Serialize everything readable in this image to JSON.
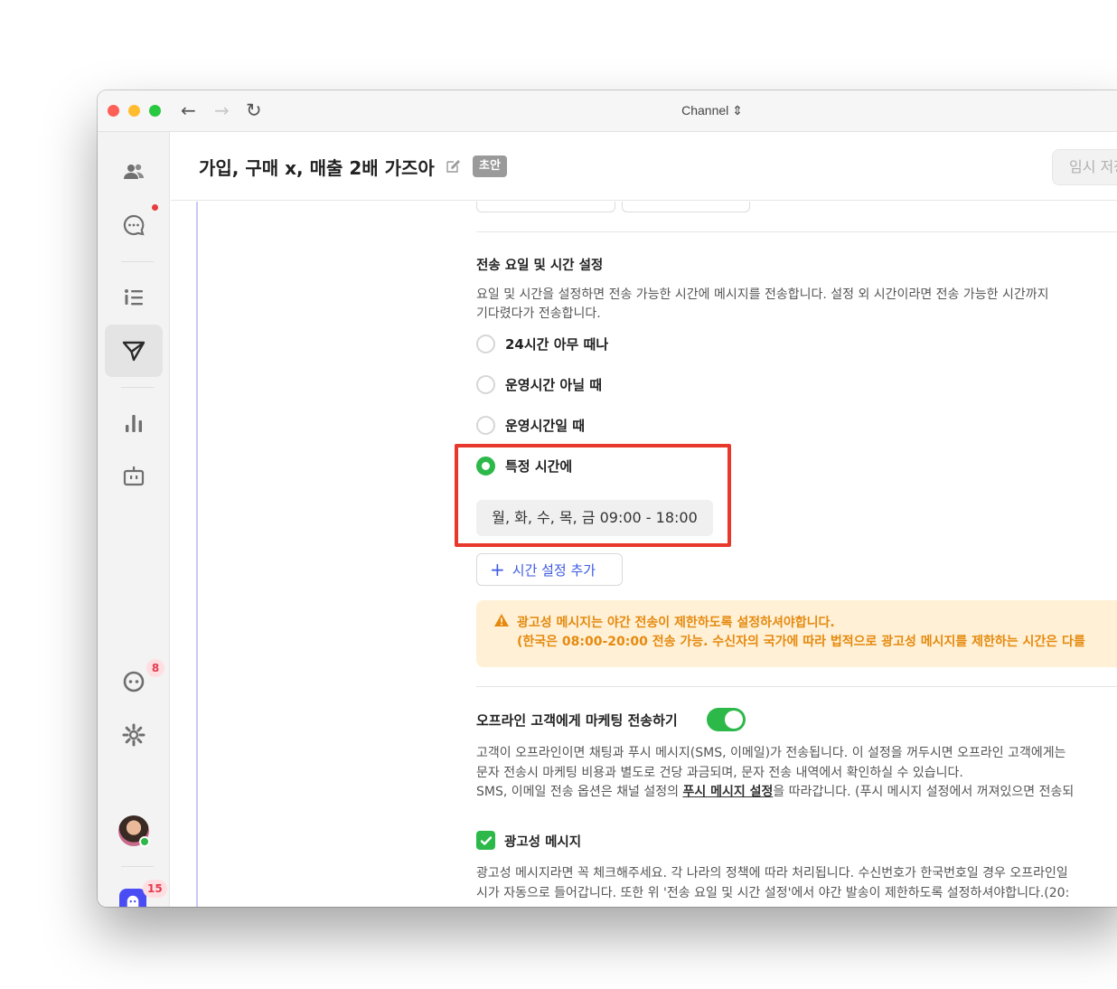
{
  "window": {
    "title": "Channel ⇕"
  },
  "nav": {
    "back": "←",
    "forward": "→",
    "reload": "↻"
  },
  "sidebar": {
    "items": [
      {
        "icon": "users-icon"
      },
      {
        "icon": "chat-icon",
        "has_dot": true
      },
      {
        "icon": "list-icon"
      },
      {
        "icon": "send-icon",
        "active": true
      },
      {
        "icon": "bar-chart-icon"
      },
      {
        "icon": "bot-icon"
      }
    ],
    "bottom": {
      "chat_badge": "8",
      "app_badge": "15"
    }
  },
  "header": {
    "title": "가입, 구매 x, 매출 2배 가즈아",
    "status_badge": "초안",
    "temp_save_label": "임시 저장"
  },
  "schedule": {
    "title": "전송 요일 및 시간 설정",
    "description_line1": "요일 및 시간을 설정하면 전송 가능한 시간에 메시지를 전송합니다. 설정 외 시간이라면 전송 가능한 시간까지",
    "description_line2": "기다렸다가 전송합니다.",
    "options": [
      {
        "label": "24시간 아무 때나",
        "checked": false
      },
      {
        "label": "운영시간 아닐 때",
        "checked": false
      },
      {
        "label": "운영시간일 때",
        "checked": false
      },
      {
        "label": "특정 시간에",
        "checked": true
      }
    ],
    "time_range": "월, 화, 수, 목, 금 09:00 - 18:00",
    "add_time_label": "시간 설정 추가"
  },
  "warning": {
    "line1": "광고성 메시지는 야간 전송이 제한하도록 설정하셔야합니다.",
    "line2": "(한국은 08:00-20:00 전송 가능. 수신자의 국가에 따라 법적으로 광고성 메시지를 제한하는 시간은 다를"
  },
  "offline": {
    "title": "오프라인 고객에게 마케팅 전송하기",
    "toggle_on": true,
    "description_line1": "고객이 오프라인이면 채팅과 푸시 메시지(SMS, 이메일)가 전송됩니다. 이 설정을 꺼두시면 오프라인 고객에게는",
    "description_line2": "문자 전송시 마케팅 비용과 별도로 건당 과금되며, 문자 전송 내역에서 확인하실 수 있습니다.",
    "description_line3_pre": "SMS, 이메일 전송 옵션은 채널 설정의 ",
    "description_line3_link": "푸시 메시지 설정",
    "description_line3_post": "을 따라갑니다. (푸시 메시지 설정에서 꺼져있으면 전송되"
  },
  "ad_message": {
    "label": "광고성 메시지",
    "checked": true,
    "description_line1": "광고성 메시지라면 꼭 체크해주세요. 각 나라의 정책에 따라 처리됩니다. 수신번호가 한국번호일 경우 오프라인일",
    "description_line2": "시가 자동으로 들어갑니다. 또한 위 '전송 요일 및 시간 설정'에서 야간 발송이 제한하도록 설정하셔야합니다.(20:"
  },
  "colors": {
    "accent_green": "#2db84a",
    "link_blue": "#3e5be0",
    "warning_orange": "#e58a0e",
    "highlight_red": "#e8382b"
  }
}
